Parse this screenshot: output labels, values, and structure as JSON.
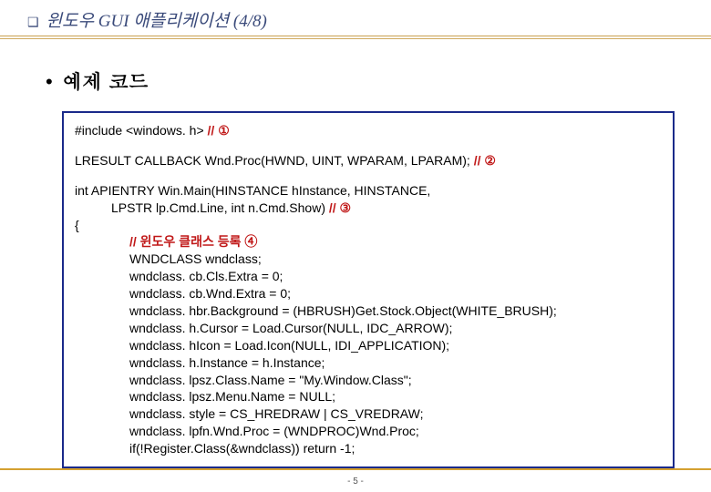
{
  "header": {
    "bullet": "❑",
    "title": "윈도우 GUI 애플리케이션 (4/8)"
  },
  "subtitle": {
    "bullet": "•",
    "text": "예제 코드"
  },
  "code": {
    "l1a": "#include <windows. h> ",
    "l1c": "// ①",
    "l2a": "LRESULT CALLBACK Wnd.Proc(HWND, UINT, WPARAM, LPARAM); ",
    "l2c": "// ②",
    "l3a": "int APIENTRY Win.Main(HINSTANCE hInstance, HINSTANCE,",
    "l3b": "LPSTR lp.Cmd.Line, int n.Cmd.Show) ",
    "l3c": "// ③",
    "l4": "{",
    "l5c": "// 윈도우 클래스 등록 ④",
    "l6": "WNDCLASS wndclass;",
    "l7": "wndclass. cb.Cls.Extra = 0;",
    "l8": "wndclass. cb.Wnd.Extra = 0;",
    "l9": "wndclass. hbr.Background = (HBRUSH)Get.Stock.Object(WHITE_BRUSH);",
    "l10": "wndclass. h.Cursor = Load.Cursor(NULL, IDC_ARROW);",
    "l11": "wndclass. hIcon = Load.Icon(NULL, IDI_APPLICATION);",
    "l12": "wndclass. h.Instance = h.Instance;",
    "l13": "wndclass. lpsz.Class.Name = \"My.Window.Class\";",
    "l14": "wndclass. lpsz.Menu.Name = NULL;",
    "l15": "wndclass. style = CS_HREDRAW | CS_VREDRAW;",
    "l16": "wndclass. lpfn.Wnd.Proc = (WNDPROC)Wnd.Proc;",
    "l17": "if(!Register.Class(&wndclass)) return -1;"
  },
  "footer": {
    "page": "- 5 -"
  }
}
